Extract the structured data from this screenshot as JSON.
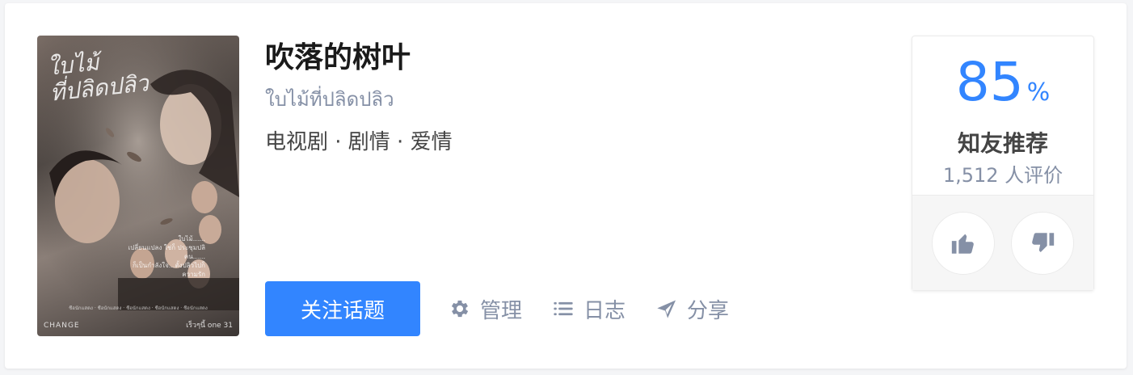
{
  "poster": {
    "title_lines": [
      "ใบไม้",
      "ที่ปลิดปลิว"
    ],
    "tagline": "ใบไม้......\nเปลี่ยนแปลง ใช่ก็ ประชุมปลิ\nคน......\nก็เป็นกำลังใจ...ตั้งปลิวไปก็\nความรัก",
    "credits": "ชื่อนักแสดง · ชื่อนักแสดง · ชื่อนักแสดง · ชื่อนักแสดง · ชื่อนักแสดง",
    "logo": "CHANGE",
    "footer": "เร็วๆนี้  one 31"
  },
  "topic": {
    "title": "吹落的树叶",
    "subtitle": "ใบไม้ที่ปลิดปลิว",
    "meta": "电视剧 · 剧情 · 爱情"
  },
  "actions": {
    "follow_label": "关注话题",
    "manage_label": "管理",
    "log_label": "日志",
    "share_label": "分享"
  },
  "rating": {
    "score": "85",
    "unit": "%",
    "label": "知友推荐",
    "count": "1,512 人评价"
  },
  "colors": {
    "accent": "#3285ff",
    "muted": "#8590a6",
    "title": "#1a1a1a",
    "body": "#444444"
  },
  "icons": {
    "manage": "gear-icon",
    "log": "list-icon",
    "share": "paper-plane-icon",
    "upvote": "thumbs-up-icon",
    "downvote": "thumbs-down-icon"
  }
}
